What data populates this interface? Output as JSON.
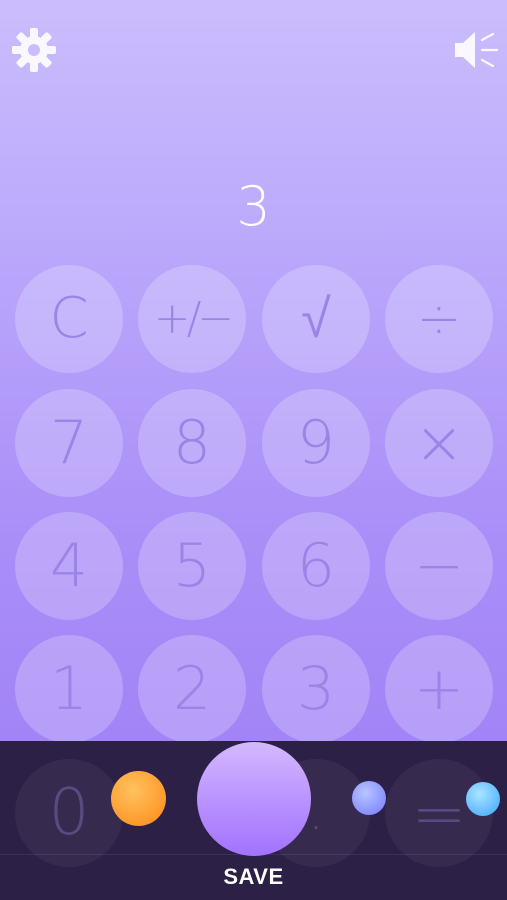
{
  "display": {
    "value": "3"
  },
  "toolbar": {
    "settings_icon": "gear-icon",
    "sound_icon": "speaker-icon"
  },
  "keys": {
    "clear": "C",
    "sign": "+/−",
    "sqrt": "√",
    "divide": "÷",
    "seven": "7",
    "eight": "8",
    "nine": "9",
    "multiply": "×",
    "four": "4",
    "five": "5",
    "six": "6",
    "minus": "−",
    "one": "1",
    "two": "2",
    "three": "3",
    "plus": "+",
    "zero": "0",
    "decimal": ".",
    "equals": "="
  },
  "overlay": {
    "save_label": "SAVE",
    "colors": {
      "orange": "#ff9a2b",
      "purple": "#8790ff",
      "blue": "#5cb7ff",
      "save": "#b68cff"
    }
  }
}
